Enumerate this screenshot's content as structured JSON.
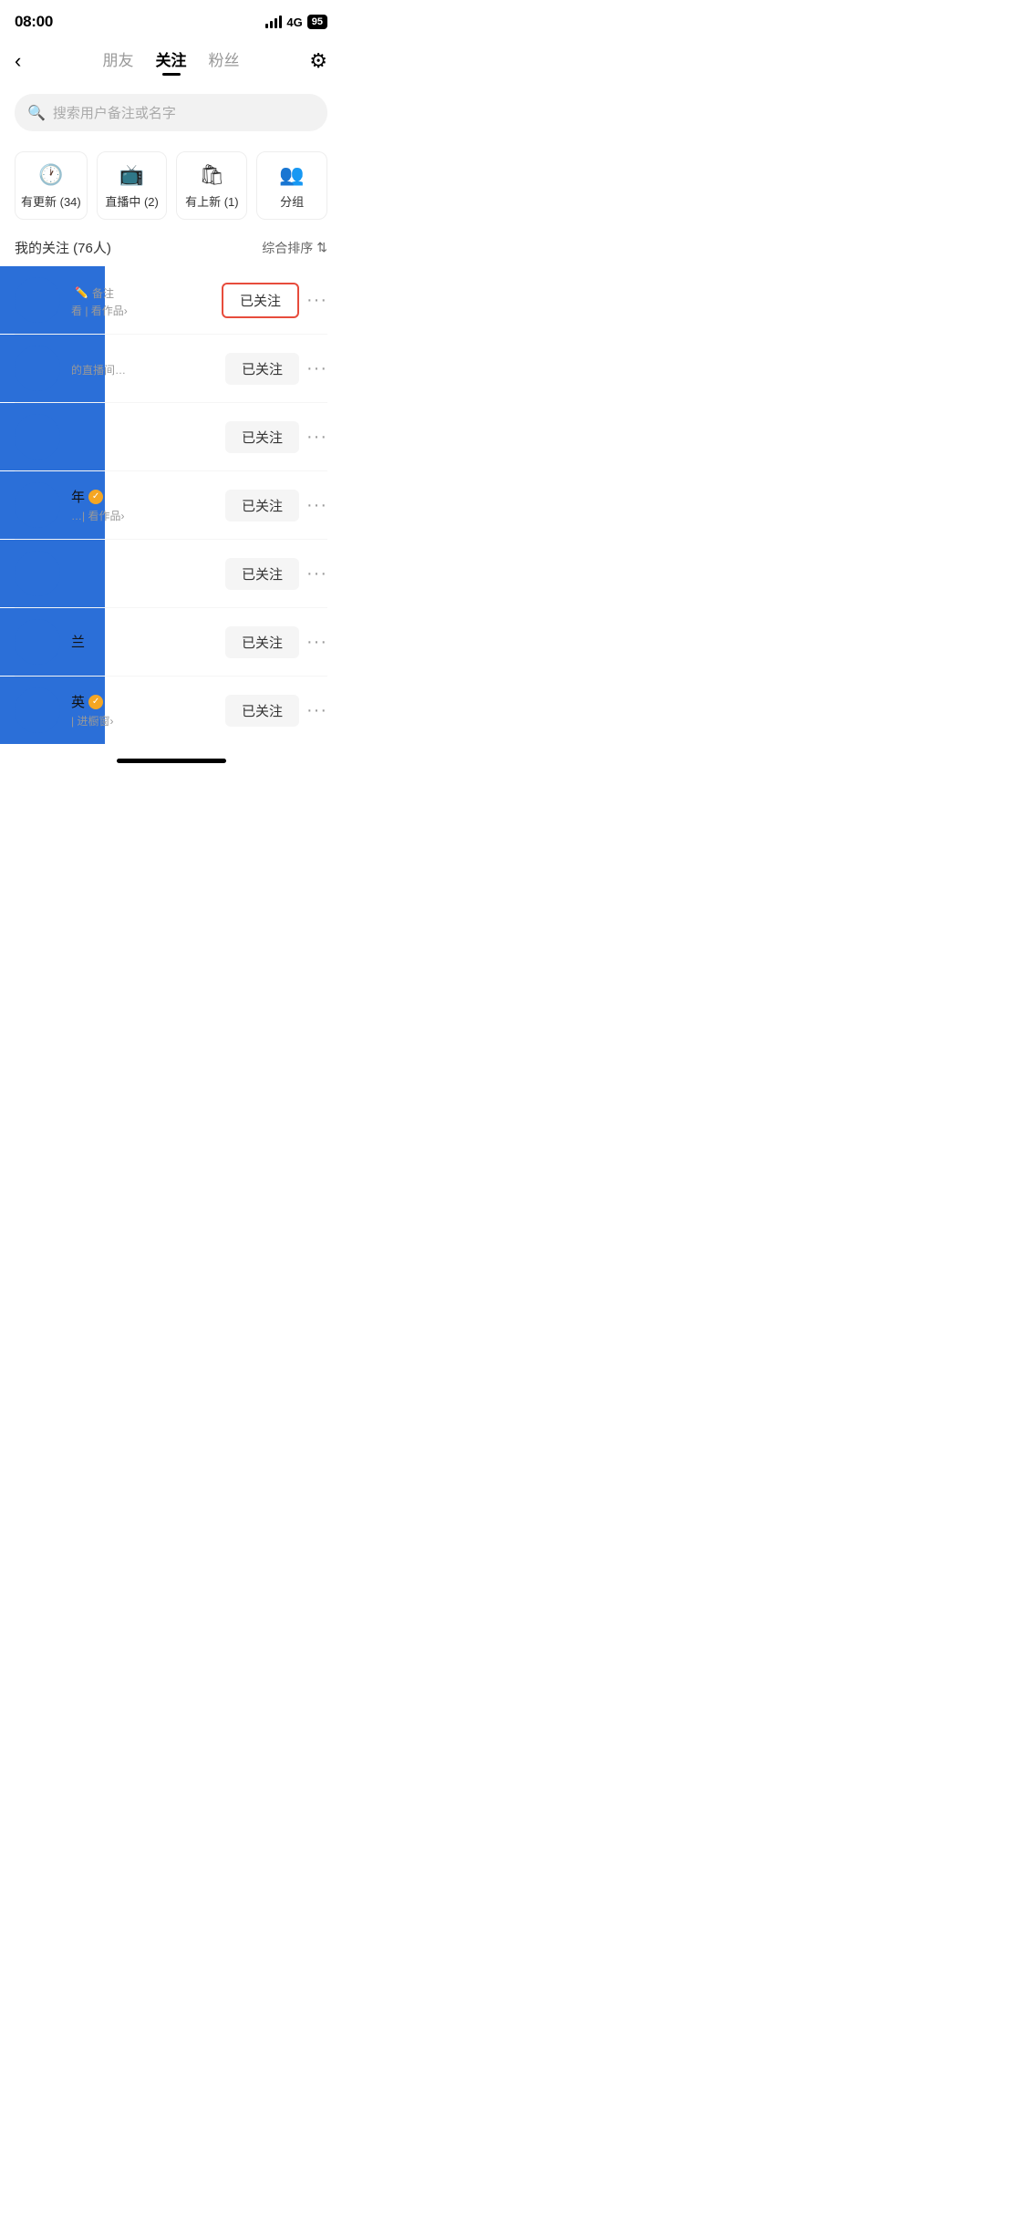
{
  "statusBar": {
    "time": "08:00",
    "network": "4G",
    "battery": "95"
  },
  "nav": {
    "backLabel": "‹",
    "tabs": [
      {
        "label": "朋友",
        "active": false
      },
      {
        "label": "关注",
        "active": true
      },
      {
        "label": "粉丝",
        "active": false
      }
    ],
    "gearIcon": "⚙"
  },
  "search": {
    "placeholder": "搜索用户备注或名字"
  },
  "filterCards": [
    {
      "icon": "🕐",
      "label": "有更新 (34)"
    },
    {
      "icon": "📺",
      "label": "直播中 (2)"
    },
    {
      "icon": "🛍",
      "label": "有上新 (1)"
    },
    {
      "icon": "👥",
      "label": "分组"
    }
  ],
  "followsHeader": {
    "count": "我的关注 (76人)",
    "sort": "综合排序"
  },
  "users": [
    {
      "id": 1,
      "hasBlueOverlay": true,
      "avatarColor": "#2b6fd8",
      "nameHidden": true,
      "hasNote": true,
      "noteLabel": "备注",
      "hasVerified": false,
      "metaText": "看 | 看作品›",
      "followLabel": "已关注",
      "highlighted": true,
      "showMore": true
    },
    {
      "id": 2,
      "hasBlueOverlay": true,
      "avatarColor": "#2b6fd8",
      "nameHidden": true,
      "hasNote": false,
      "hasVerified": false,
      "metaText": "的直播间…",
      "followLabel": "已关注",
      "highlighted": false,
      "showMore": true
    },
    {
      "id": 3,
      "hasBlueOverlay": true,
      "avatarColor": "#2b6fd8",
      "nameHidden": true,
      "hasNote": false,
      "hasVerified": false,
      "metaText": "",
      "followLabel": "已关注",
      "highlighted": false,
      "showMore": true
    },
    {
      "id": 4,
      "hasBlueOverlay": true,
      "avatarColor": "#2b6fd8",
      "nameHidden": true,
      "nameSuffix": "年",
      "hasNote": false,
      "hasVerified": true,
      "metaText": "…| 看作品›",
      "followLabel": "已关注",
      "highlighted": false,
      "showMore": true
    },
    {
      "id": 5,
      "hasBlueOverlay": true,
      "avatarColor": "#2b6fd8",
      "nameHidden": true,
      "hasNote": false,
      "hasVerified": false,
      "metaText": "",
      "followLabel": "已关注",
      "highlighted": false,
      "showMore": true
    },
    {
      "id": 6,
      "hasBlueOverlay": true,
      "avatarColor": "#2b6fd8",
      "nameHidden": true,
      "nameSuffix": "兰",
      "hasNote": false,
      "hasVerified": false,
      "metaText": "",
      "followLabel": "已关注",
      "highlighted": false,
      "showMore": true
    },
    {
      "id": 7,
      "hasBlueOverlay": true,
      "avatarColor": "#2b6fd8",
      "nameHidden": true,
      "nameSuffix": "英",
      "hasNote": false,
      "hasVerified": true,
      "metaText": "| 进橱窗›",
      "followLabel": "已关注",
      "highlighted": false,
      "showMore": true
    }
  ]
}
